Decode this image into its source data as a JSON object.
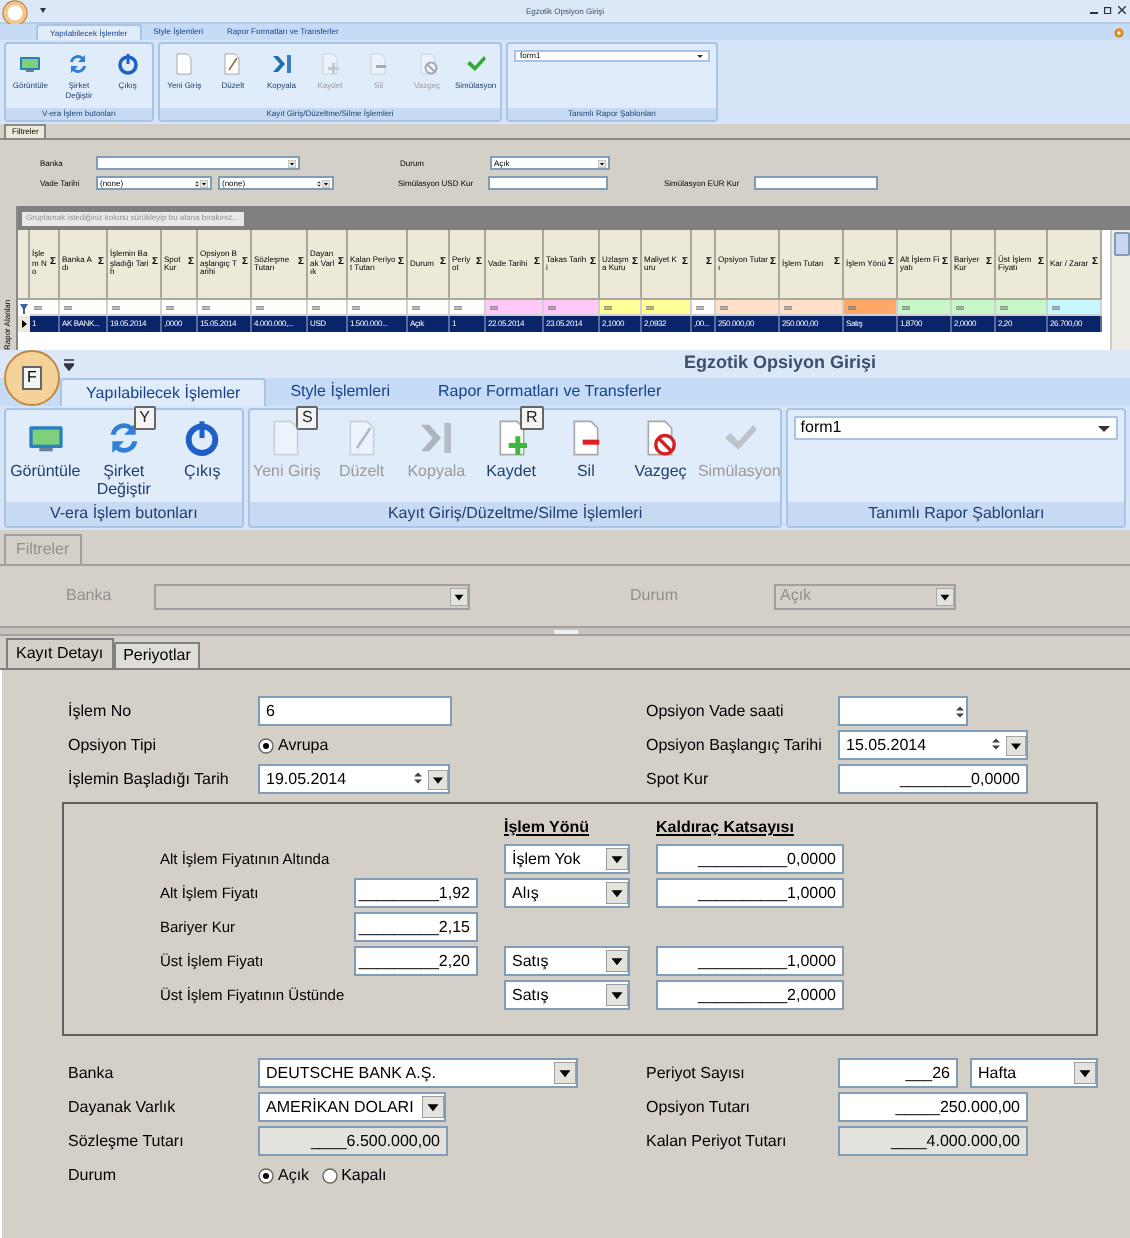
{
  "mini": {
    "title": "Egzotik Opsiyon Girişi",
    "tabs": [
      {
        "label": "Yapılabilecek İşlemler",
        "selected": true
      },
      {
        "label": "Style İşlemleri",
        "selected": false
      },
      {
        "label": "Rapor Formatları ve Transferler",
        "selected": false
      }
    ],
    "groups": [
      {
        "kind": "buttons",
        "label": "V-era İşlem butonları",
        "buttons": [
          {
            "label": "Görüntüle",
            "kind": "display",
            "disabled": false
          },
          {
            "label": "Şirket Değiştir",
            "kind": "switch",
            "disabled": false
          },
          {
            "label": "Çıkış",
            "kind": "power",
            "disabled": false
          }
        ]
      },
      {
        "kind": "buttons",
        "label": "Kayıt Giriş/Düzeltme/Silme İşlemleri",
        "buttons": [
          {
            "label": "Yeni Giriş",
            "kind": "new",
            "disabled": false
          },
          {
            "label": "Düzelt",
            "kind": "edit",
            "disabled": false
          },
          {
            "label": "Kopyala",
            "kind": "copy",
            "disabled": false
          },
          {
            "label": "Kaydet",
            "kind": "save",
            "disabled": true
          },
          {
            "label": "Sil",
            "kind": "delete",
            "disabled": true
          },
          {
            "label": "Vazgeç",
            "kind": "cancel",
            "disabled": true
          },
          {
            "label": "Simülasyon",
            "kind": "check",
            "disabled": false
          }
        ]
      },
      {
        "kind": "template",
        "label": "Tanımlı Rapor Şablonları",
        "value": "form1"
      }
    ],
    "filter_tab": "Filtreler",
    "filters": {
      "bank": "Banka",
      "status": "Durum",
      "status_value": "Açık",
      "maturity": "Vade Tarihi",
      "maturity_from": "(none)",
      "maturity_to": "(none)",
      "usd": "Simülasyon USD Kur",
      "eur": "Simülasyon EUR Kur"
    },
    "group_hint": "Gruplamak istediğiniz kolonu sürükleyip bu alana bırakınız...",
    "side_tab": "Rapor Alanları",
    "columns": [
      {
        "label": "İşlem No",
        "sum": "Σ",
        "color": "#ffffff"
      },
      {
        "label": "Banka Adı",
        "sum": "Σ",
        "color": "#ffffff"
      },
      {
        "label": "İşlemin Başladığı Tarih",
        "sum": "Σ",
        "color": "#ffffff"
      },
      {
        "label": "Spot Kur",
        "sum": "Σ",
        "color": "#ffffff"
      },
      {
        "label": "Opsiyon Başlangıç Tarihi",
        "sum": "Σ",
        "color": "#ffffff"
      },
      {
        "label": "Sözleşme Tutarı",
        "sum": "Σ",
        "color": "#ffffff"
      },
      {
        "label": "Dayanak Varlık",
        "sum": "Σ",
        "color": "#ffffff"
      },
      {
        "label": "Kalan Periyot Tutarı",
        "sum": "Σ",
        "color": "#ffffff"
      },
      {
        "label": "Durum",
        "sum": "Σ",
        "color": "#ffffff"
      },
      {
        "label": "Periyot",
        "sum": "Σ",
        "color": "#ffffff"
      },
      {
        "label": "Vade Tarihi",
        "sum": "Σ",
        "color": "#ffc8f8"
      },
      {
        "label": "Takas Tarihi",
        "sum": "Σ",
        "color": "#ffc8f8"
      },
      {
        "label": "Uzlaşma Kuru",
        "sum": "Σ",
        "color": "#ffff99"
      },
      {
        "label": "Maliyet Kuru",
        "sum": "Σ",
        "color": "#ffff99"
      },
      {
        "sum": "Σ",
        "color": "#ffffff"
      },
      {
        "label": "Opsiyon Tutarı",
        "sum": "Σ",
        "color": "#ffe0c8"
      },
      {
        "label": "İşlem Tutarı",
        "sum": "Σ",
        "color": "#ffe0c8"
      },
      {
        "label": "İşlem Yönü",
        "sum": "Σ",
        "color": "#ffa868"
      },
      {
        "label": "Alt İşlem Fiyatı",
        "sum": "Σ",
        "color": "#c8f8c8"
      },
      {
        "label": "Bariyer Kur",
        "sum": "Σ",
        "color": "#c8f8c8"
      },
      {
        "label": "Üst İşlem Fiyatı",
        "sum": "Σ",
        "color": "#c8f8c8"
      },
      {
        "label": "Kar / Zarar",
        "sum": "Σ",
        "color": "#c8f8ff"
      }
    ],
    "row": {
      "selected": true,
      "cells": [
        "1",
        "AK BANK...",
        "19.05.2014",
        ",0000",
        "15.05.2014",
        "4.000.000,...",
        "USD",
        "1.500.000...",
        "Açık",
        "1",
        "22.05.2014",
        "23.05.2014",
        "2,1000",
        "2,0932",
        ",00...",
        "250.000,00",
        "250.000,00",
        "Satış",
        "1,8700",
        "2,0000",
        "2,20",
        "26.700,00"
      ]
    }
  },
  "main": {
    "title": "Egzotik Opsiyon Girişi",
    "orb_keytip": "F",
    "tabs": [
      {
        "label": "Yapılabilecek İşlemler",
        "selected": true
      },
      {
        "label": "Style İşlemleri",
        "selected": false
      },
      {
        "label": "Rapor Formatları ve Transferler",
        "selected": false
      }
    ],
    "groups": [
      {
        "kind": "buttons",
        "label": "V-era İşlem butonları",
        "buttons": [
          {
            "label": "Görüntüle",
            "kind": "display",
            "disabled": false
          },
          {
            "label": "Şirket Değiştir",
            "kind": "switch",
            "disabled": false,
            "keytip": "Y"
          },
          {
            "label": "Çıkış",
            "kind": "power",
            "disabled": false
          }
        ]
      },
      {
        "kind": "buttons",
        "label": "Kayıt  Giriş/Düzeltme/Silme İşlemleri",
        "buttons": [
          {
            "label": "Yeni Giriş",
            "kind": "new",
            "disabled": true,
            "keytip": "S"
          },
          {
            "label": "Düzelt",
            "kind": "edit",
            "disabled": true
          },
          {
            "label": "Kopyala",
            "kind": "copy",
            "disabled": true
          },
          {
            "label": "Kaydet",
            "kind": "save",
            "disabled": false,
            "keytip": "R"
          },
          {
            "label": "Sil",
            "kind": "delete",
            "disabled": false
          },
          {
            "label": "Vazgeç",
            "kind": "cancel",
            "disabled": false
          },
          {
            "label": "Simülasyon",
            "kind": "check",
            "disabled": true
          }
        ]
      },
      {
        "kind": "template",
        "label": "Tanımlı Rapor Şablonları",
        "value": "form1"
      }
    ],
    "filter_tab": "Filtreler",
    "filters": {
      "disabled": true,
      "bank": "Banka",
      "status": "Durum",
      "status_value": "Açık"
    },
    "detail_tabs": [
      {
        "label": "Kayıt Detayı",
        "selected": true
      },
      {
        "label": "Periyotlar",
        "selected": false
      }
    ],
    "top_left": [
      {
        "label": "İşlem No",
        "kind": "text",
        "value": "6"
      },
      {
        "label": "Opsiyon Tipi",
        "kind": "radio",
        "options": [
          {
            "label": "Avrupa",
            "selected": true
          }
        ]
      },
      {
        "label": "İşlemin Başladığı Tarih",
        "kind": "date",
        "value": "19.05.2014"
      }
    ],
    "top_right": [
      {
        "label": "Opsiyon Vade saati",
        "kind": "spin"
      },
      {
        "label": "Opsiyon Başlangıç Tarihi",
        "kind": "date",
        "value": "15.05.2014"
      },
      {
        "label": "Spot Kur",
        "kind": "text",
        "value": "________0,0000"
      }
    ],
    "barrier": {
      "direction_header": "İşlem Yönü",
      "coefficient_header": "Kaldıraç Katsayısı",
      "rows": [
        {
          "label": "Alt İşlem Fiyatının Altında",
          "direction": "İşlem Yok",
          "coefficient": "__________0,0000"
        },
        {
          "label": "Alt İşlem Fiyatı",
          "price": "_________1,92",
          "direction": "Alış",
          "coefficient": "__________1,0000"
        },
        {
          "label": "Bariyer Kur",
          "price": "_________2,15"
        },
        {
          "label": "Üst İşlem Fiyatı",
          "price": "_________2,20",
          "direction": "Satış",
          "coefficient": "__________1,0000"
        },
        {
          "label": "Üst İşlem Fiyatının Üstünde",
          "direction": "Satış",
          "coefficient": "__________2,0000"
        }
      ]
    },
    "bottom_left": [
      {
        "label": "Banka",
        "kind": "select",
        "value": "DEUTSCHE BANK A.Ş."
      },
      {
        "label": "Dayanak Varlık",
        "kind": "select",
        "value": "AMERİKAN DOLARI"
      },
      {
        "label": "Sözleşme Tutarı",
        "kind": "readonly",
        "value": "____6.500.000,00"
      },
      {
        "label": "Durum",
        "kind": "radio",
        "options": [
          {
            "label": "Açık",
            "selected": true
          },
          {
            "label": "Kapalı",
            "selected": false
          }
        ]
      }
    ],
    "bottom_right": [
      {
        "label": "Periyot Sayısı",
        "kind": "unit",
        "value": "___26",
        "unit": "Hafta"
      },
      {
        "label": "Opsiyon Tutarı",
        "kind": "text",
        "value": "_____250.000,00"
      },
      {
        "label": "Kalan Periyot Tutarı",
        "kind": "readonly",
        "value": "____4.000.000,00"
      }
    ]
  }
}
